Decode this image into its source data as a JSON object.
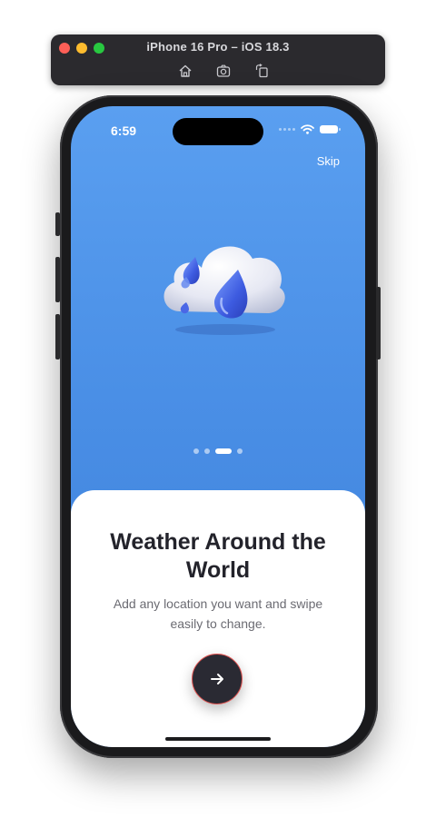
{
  "simulator": {
    "title": "iPhone 16 Pro – iOS 18.3",
    "tools": [
      "home-icon",
      "screenshot-icon",
      "rotate-icon"
    ]
  },
  "status_bar": {
    "time": "6:59"
  },
  "onboarding": {
    "skip_label": "Skip",
    "headline": "Weather Around the World",
    "subtitle": "Add any location you want and swipe easily to change.",
    "page_count": 4,
    "active_page": 3,
    "next_icon": "arrow-right-icon"
  },
  "colors": {
    "hero_bg": "#4a8fe6",
    "sheet_bg": "#ffffff",
    "button_bg": "#2a2a33",
    "button_border": "#e25452"
  }
}
